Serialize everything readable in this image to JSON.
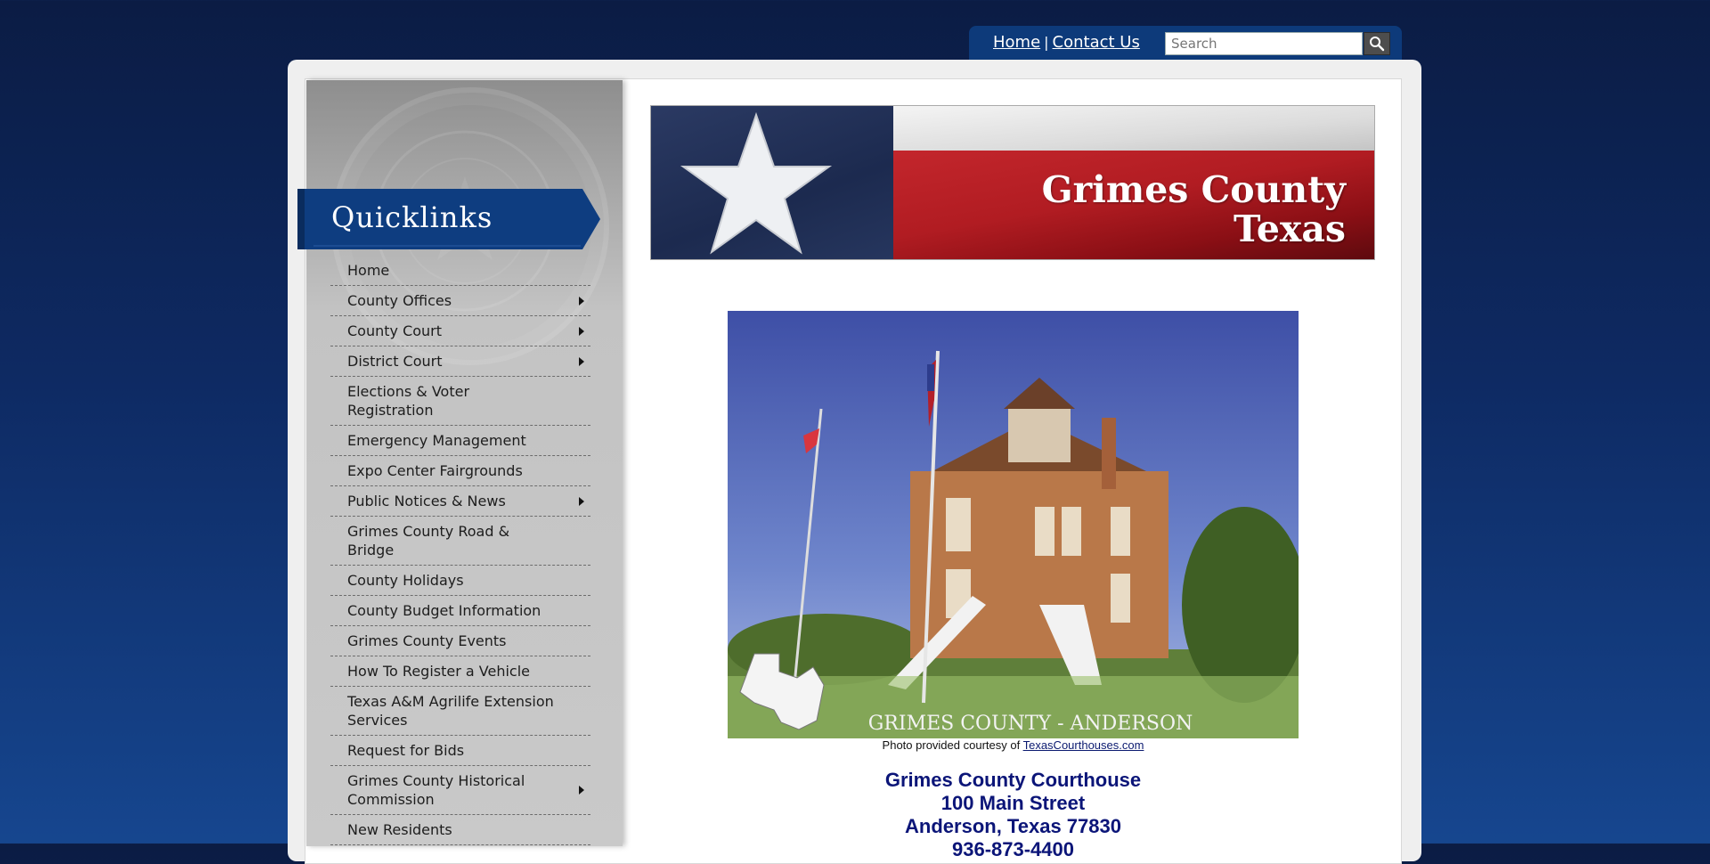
{
  "utility": {
    "home_label": "Home",
    "separator": "|",
    "contact_label": "Contact Us",
    "search_placeholder": "Search"
  },
  "sidebar": {
    "heading": "Quicklinks",
    "items": [
      {
        "label": "Home",
        "has_submenu": false
      },
      {
        "label": "County Offices",
        "has_submenu": true
      },
      {
        "label": "County Court",
        "has_submenu": true
      },
      {
        "label": "District Court",
        "has_submenu": true
      },
      {
        "label": "Elections & Voter Registration",
        "has_submenu": false
      },
      {
        "label": "Emergency Management",
        "has_submenu": false
      },
      {
        "label": "Expo Center Fairgrounds",
        "has_submenu": false
      },
      {
        "label": "Public Notices & News",
        "has_submenu": true
      },
      {
        "label": "Grimes County Road & Bridge",
        "has_submenu": false
      },
      {
        "label": "County Holidays",
        "has_submenu": false
      },
      {
        "label": "County Budget Information",
        "has_submenu": false
      },
      {
        "label": "Grimes County Events",
        "has_submenu": false
      },
      {
        "label": "How To Register a Vehicle",
        "has_submenu": false
      },
      {
        "label": "Texas A&M Agrilife Extension Services",
        "has_submenu": false
      },
      {
        "label": "Request for Bids",
        "has_submenu": false
      },
      {
        "label": "Grimes County Historical Commission",
        "has_submenu": true
      },
      {
        "label": "New Residents",
        "has_submenu": false
      }
    ]
  },
  "header": {
    "title_line1": "Grimes County",
    "title_line2": "Texas"
  },
  "photo": {
    "overlay_text": "GRIMES COUNTY - ANDERSON",
    "caption_prefix": "Photo provided courtesy of",
    "caption_link": "TexasCourthouses.com"
  },
  "address": {
    "line1": "Grimes County Courthouse",
    "line2": "100 Main Street",
    "line3": "Anderson, Texas 77830",
    "line4": "936-873-4400"
  },
  "colors": {
    "background_top": "#0b1c44",
    "background_bottom": "#16468f",
    "banner_blue": "#0d3a7a",
    "address_text": "#0b1578",
    "flag_red": "#b11c22"
  }
}
